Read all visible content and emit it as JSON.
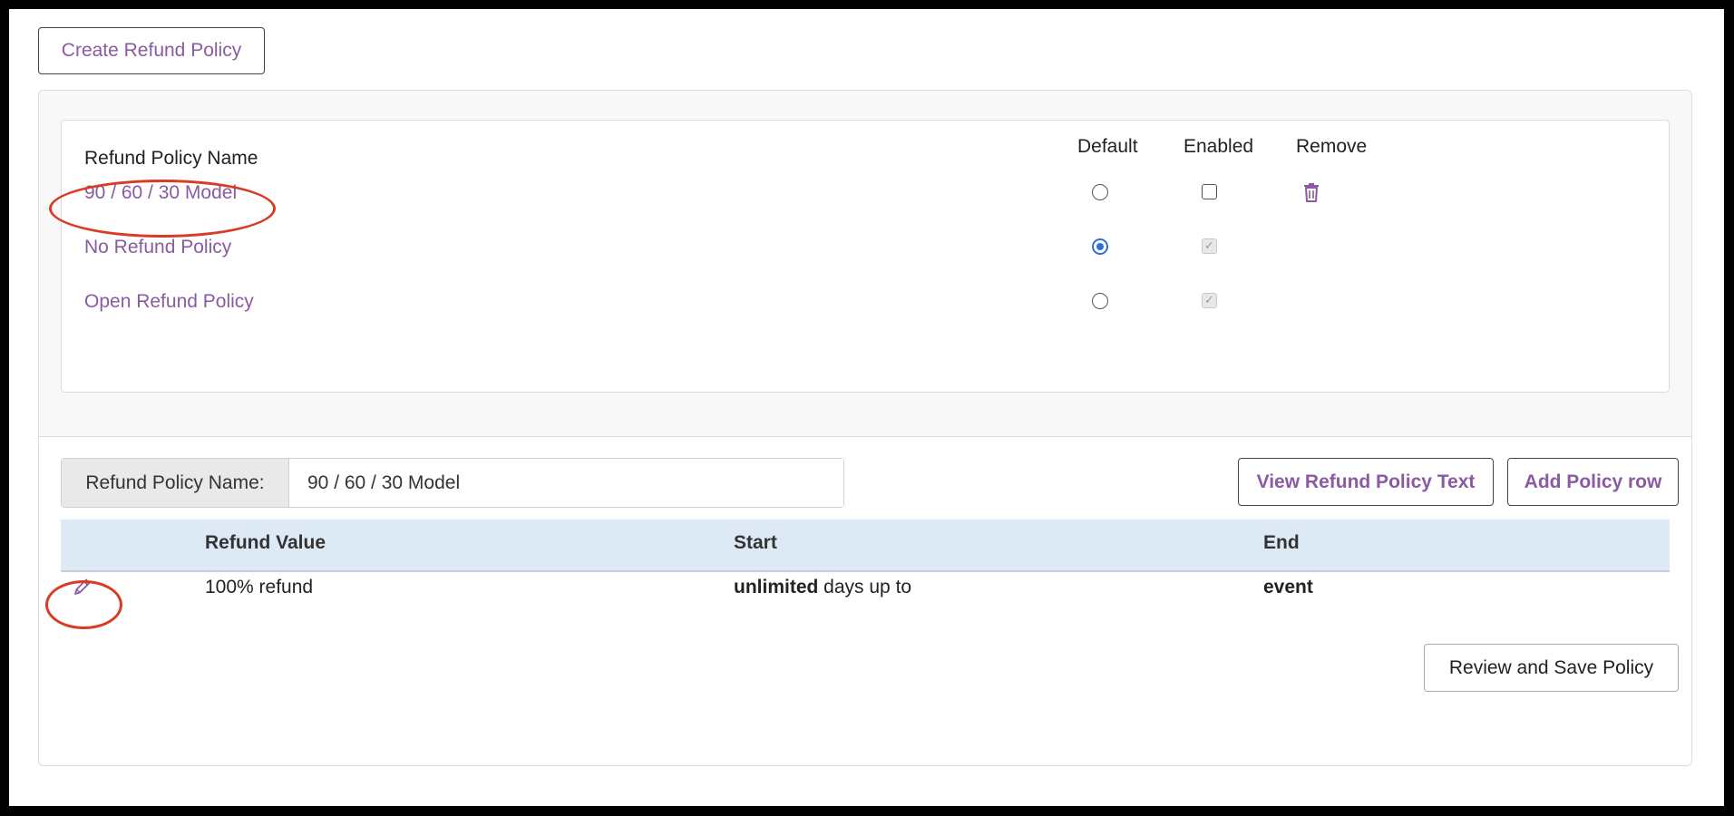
{
  "create_button": "Create Refund Policy",
  "policy_list": {
    "headers": {
      "name": "Refund Policy Name",
      "default": "Default",
      "enabled": "Enabled",
      "remove": "Remove"
    },
    "policies": [
      {
        "name": "90 / 60 / 30 Model",
        "default": false,
        "enabled": false,
        "enabled_disabled": false,
        "removable": true
      },
      {
        "name": "No Refund Policy",
        "default": true,
        "enabled": true,
        "enabled_disabled": true,
        "removable": false
      },
      {
        "name": "Open Refund Policy",
        "default": false,
        "enabled": true,
        "enabled_disabled": true,
        "removable": false
      }
    ]
  },
  "editor": {
    "name_label": "Refund Policy Name:",
    "name_value": "90 / 60 / 30 Model",
    "view_text_button": "View Refund Policy Text",
    "add_row_button": "Add Policy row",
    "table": {
      "headers": [
        "Refund Value",
        "Start",
        "End"
      ],
      "rows": [
        {
          "value": "100% refund",
          "start_bold": "unlimited",
          "start_rest": " days up to",
          "end": "event"
        }
      ]
    },
    "save_button": "Review and Save Policy"
  },
  "icons": {
    "remove": "trash-icon",
    "edit_row": "pencil-icon"
  },
  "colors": {
    "link": "#8a5aa3",
    "radio_selected": "#2f6fe4",
    "table_header_bg": "#dde9f5",
    "annotation": "#d93b24"
  }
}
